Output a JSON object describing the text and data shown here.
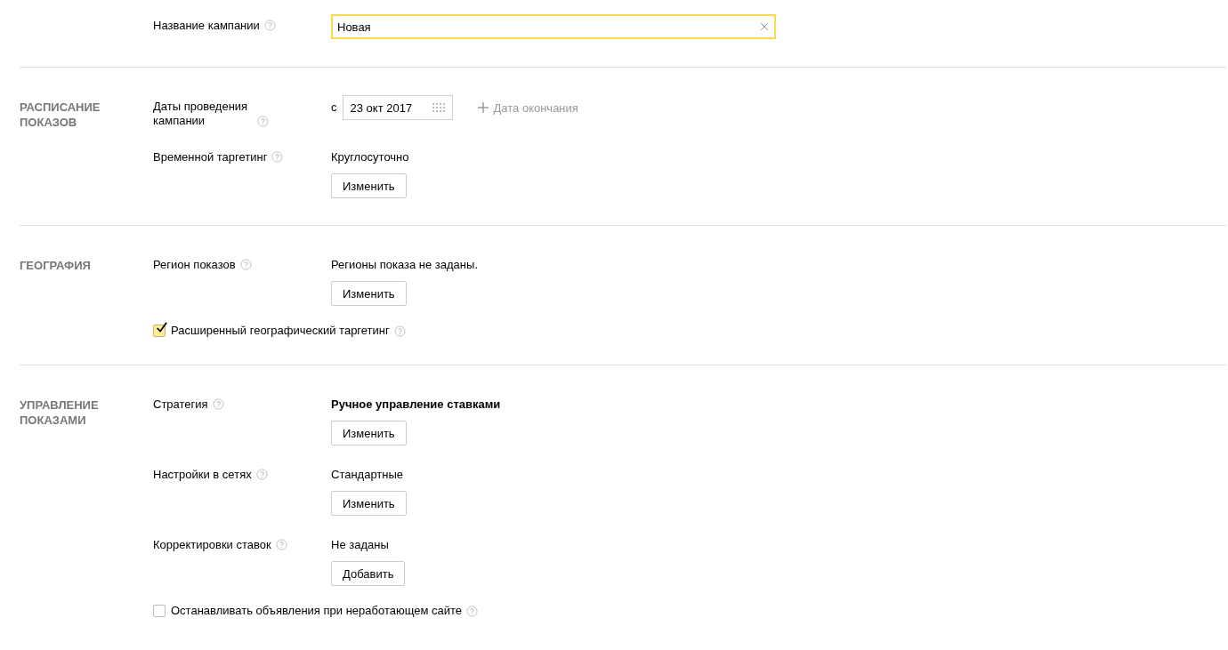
{
  "sections": [
    {
      "rows": [
        {
          "kind": "input",
          "label": "Название кампании",
          "value": "Новая"
        }
      ]
    },
    {
      "title": "РАСПИСАНИЕ ПОКАЗОВ",
      "rows": [
        {
          "kind": "date",
          "label": "Даты проведения кампании",
          "prefix": "с",
          "date": "23 окт 2017",
          "add_link": "Дата окончания"
        },
        {
          "kind": "value_button",
          "label": "Временной таргетинг",
          "value": "Круглосуточно",
          "emphasis": false,
          "button": "Изменить"
        }
      ]
    },
    {
      "title": "ГЕОГРАФИЯ",
      "rows": [
        {
          "kind": "value_button",
          "label": "Регион показов",
          "value": "Регионы показа не заданы.",
          "emphasis": false,
          "button": "Изменить"
        },
        {
          "kind": "checkbox",
          "label": "Расширенный географический таргетинг",
          "checked": true
        }
      ]
    },
    {
      "title": "УПРАВЛЕНИЕ ПОКАЗАМИ",
      "rows": [
        {
          "kind": "value_button",
          "label": "Стратегия",
          "value": "Ручное управление ставками",
          "emphasis": true,
          "button": "Изменить"
        },
        {
          "kind": "value_button",
          "label": "Настройки в сетях",
          "value": "Стандартные",
          "emphasis": false,
          "button": "Изменить"
        },
        {
          "kind": "value_button",
          "label": "Корректировки ставок",
          "value": "Не заданы",
          "emphasis": false,
          "button": "Добавить"
        },
        {
          "kind": "checkbox",
          "label": "Останавливать объявления при неработающем сайте",
          "checked": false
        }
      ]
    }
  ]
}
